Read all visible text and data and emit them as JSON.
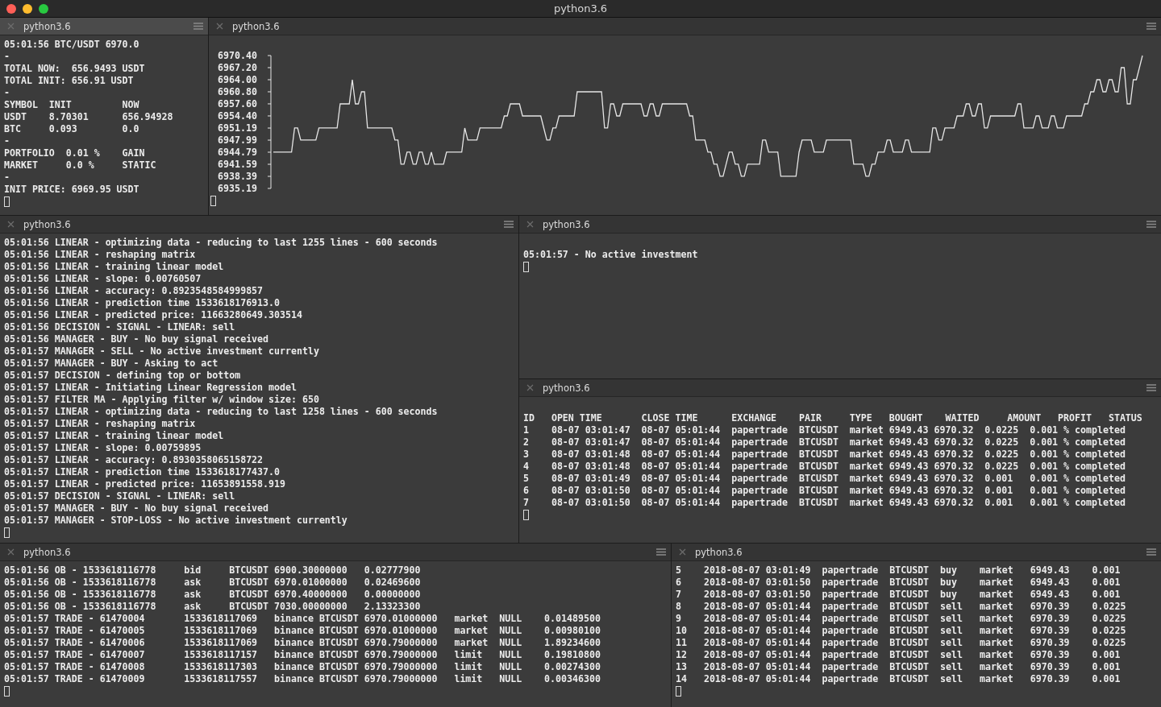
{
  "window": {
    "title": "python3.6"
  },
  "panes": [
    {
      "title": "python3.6",
      "selected": true,
      "kind": "text",
      "lines": [
        "05:01:56 BTC/USDT 6970.0",
        "-",
        "TOTAL NOW:  656.9493 USDT",
        "TOTAL INIT: 656.91 USDT",
        "-",
        "SYMBOL  INIT         NOW",
        "USDT    8.70301      656.94928",
        "BTC     0.093        0.0",
        "-",
        "PORTFOLIO  0.01 %    GAIN",
        "MARKET     0.0 %     STATIC",
        "-",
        "INIT PRICE: 6969.95 USDT"
      ]
    },
    {
      "title": "python3.6",
      "selected": false,
      "kind": "chart",
      "chart_data": {
        "type": "line",
        "ylim": [
          6935.19,
          6970.4
        ],
        "yticks": [
          {
            "value": 6970.4,
            "label": "6970.40"
          },
          {
            "value": 6967.2,
            "label": "6967.20"
          },
          {
            "value": 6964.0,
            "label": "6964.00"
          },
          {
            "value": 6960.8,
            "label": "6960.80"
          },
          {
            "value": 6957.6,
            "label": "6957.60"
          },
          {
            "value": 6954.4,
            "label": "6954.40"
          },
          {
            "value": 6951.19,
            "label": "6951.19"
          },
          {
            "value": 6947.99,
            "label": "6947.99"
          },
          {
            "value": 6944.79,
            "label": "6944.79"
          },
          {
            "value": 6941.59,
            "label": "6941.59"
          },
          {
            "value": 6938.39,
            "label": "6938.39"
          },
          {
            "value": 6935.19,
            "label": "6935.19"
          }
        ],
        "categories": [
          null,
          null,
          null,
          null,
          null,
          null,
          null,
          null,
          null,
          null,
          null,
          null,
          null,
          null,
          null,
          null,
          null,
          null,
          null,
          null,
          null,
          null,
          null,
          null,
          null,
          null,
          null,
          null,
          null,
          null,
          null,
          null,
          null,
          null,
          null,
          null,
          null,
          null,
          null,
          null,
          null,
          null,
          null,
          null,
          null,
          null,
          null,
          null,
          null,
          null,
          null,
          null,
          null,
          null,
          null,
          null,
          null,
          null,
          null,
          null,
          null,
          null,
          null,
          null,
          null,
          null,
          null,
          null,
          null,
          null,
          null,
          null,
          null,
          null,
          null,
          null,
          null,
          null,
          null,
          null,
          null,
          null,
          null,
          null,
          null,
          null,
          null,
          null,
          null,
          null,
          null,
          null,
          null,
          null,
          null,
          null,
          null,
          null,
          null,
          null,
          null,
          null,
          null,
          null,
          null,
          null,
          null,
          null,
          null,
          null,
          null,
          null,
          null,
          null,
          null,
          null,
          null,
          null,
          null,
          null,
          null,
          null,
          null,
          null,
          null,
          null,
          null,
          null,
          null,
          null,
          null,
          null,
          null,
          null,
          null,
          null,
          null,
          null,
          null,
          null,
          null,
          null,
          null,
          null,
          null,
          null,
          null,
          null,
          null,
          null,
          null,
          null,
          null,
          null,
          null,
          null,
          null,
          null,
          null,
          null,
          null,
          null,
          null,
          null,
          null,
          null,
          null,
          null,
          null,
          null,
          null,
          null,
          null,
          null,
          null,
          null,
          null,
          null,
          null,
          null,
          null,
          null,
          null,
          null,
          null,
          null,
          null,
          null,
          null,
          null,
          null,
          null,
          null,
          null,
          null,
          null,
          null,
          null,
          null,
          null,
          null,
          null,
          null,
          null,
          null,
          null,
          null,
          null,
          null,
          null,
          null,
          null,
          null,
          null,
          null,
          null,
          null,
          null,
          null,
          null,
          null,
          null,
          null,
          null,
          null,
          null,
          null,
          null,
          null,
          null,
          null,
          null,
          null,
          null,
          null,
          null,
          null,
          null,
          null,
          null,
          null,
          null,
          null,
          null,
          null,
          null,
          null,
          null,
          null,
          null,
          null,
          null,
          null,
          null,
          null,
          null,
          null,
          null,
          null,
          null,
          null,
          null,
          null,
          null,
          null,
          null,
          null,
          null,
          null,
          null,
          null,
          null,
          null,
          null,
          null,
          null,
          null,
          null,
          null,
          null,
          null,
          null,
          null,
          null,
          null,
          null,
          null
        ],
        "series": [
          {
            "color": "#e6e6e6",
            "values": [
              6944.8,
              6944.8,
              6944.8,
              6944.8,
              6944.8,
              6944.8,
              6944.8,
              6951.2,
              6951.2,
              6948,
              6948,
              6948,
              6948,
              6948,
              6948,
              6951.2,
              6951.2,
              6951.2,
              6951.2,
              6951.2,
              6951.2,
              6951.2,
              6957.6,
              6957.6,
              6957.6,
              6957.6,
              6964,
              6957.6,
              6957.6,
              6960.8,
              6960.8,
              6951.2,
              6951.2,
              6951.2,
              6951.2,
              6951.2,
              6951.2,
              6951.2,
              6951.2,
              6951.2,
              6948,
              6948,
              6941.6,
              6941.6,
              6944.8,
              6944.8,
              6941.6,
              6941.6,
              6944.8,
              6944.8,
              6941.6,
              6941.6,
              6944.8,
              6941.6,
              6941.6,
              6941.6,
              6941.6,
              6944.8,
              6944.8,
              6944.8,
              6944.8,
              6944.8,
              6944.8,
              6951.2,
              6948,
              6948,
              6948,
              6948,
              6951.2,
              6951.2,
              6951.2,
              6951.2,
              6951.2,
              6951.2,
              6951.2,
              6951.2,
              6954.4,
              6954.4,
              6957.6,
              6957.6,
              6957.6,
              6957.6,
              6954.4,
              6954.4,
              6954.4,
              6954.4,
              6954.4,
              6954.4,
              6954.4,
              6951.2,
              6948,
              6948,
              6951.2,
              6951.2,
              6954.4,
              6954.4,
              6954.4,
              6954.4,
              6954.4,
              6954.4,
              6960.8,
              6960.8,
              6960.8,
              6960.8,
              6960.8,
              6960.8,
              6960.8,
              6960.8,
              6960.8,
              6951.2,
              6951.2,
              6957.6,
              6957.6,
              6954.4,
              6954.4,
              6957.6,
              6957.6,
              6957.6,
              6957.6,
              6957.6,
              6957.6,
              6957.6,
              6954.4,
              6954.4,
              6957.6,
              6957.6,
              6954.4,
              6954.4,
              6957.6,
              6957.6,
              6957.6,
              6957.6,
              6957.6,
              6957.6,
              6957.6,
              6957.6,
              6957.6,
              6954.4,
              6954.4,
              6948,
              6948,
              6948,
              6948,
              6944.8,
              6944.8,
              6941.6,
              6941.6,
              6938.4,
              6938.4,
              6941.6,
              6944.8,
              6944.8,
              6941.6,
              6941.6,
              6938.4,
              6938.4,
              6941.6,
              6941.6,
              6941.6,
              6941.6,
              6941.6,
              6948,
              6948,
              6944.8,
              6944.8,
              6944.8,
              6944.8,
              6938.4,
              6938.4,
              6938.4,
              6938.4,
              6938.4,
              6938.4,
              6944.8,
              6948,
              6948,
              6948,
              6948,
              6944.8,
              6944.8,
              6944.8,
              6944.8,
              6948,
              6948,
              6948,
              6948,
              6948,
              6948,
              6948,
              6948,
              6948,
              6941.6,
              6941.6,
              6941.6,
              6941.6,
              6938.4,
              6938.4,
              6941.6,
              6941.6,
              6944.8,
              6944.8,
              6944.8,
              6948,
              6948,
              6944.8,
              6944.8,
              6944.8,
              6944.8,
              6948,
              6948,
              6944.8,
              6944.8,
              6944.8,
              6944.8,
              6944.8,
              6944.8,
              6944.8,
              6951.2,
              6951.2,
              6948,
              6948,
              6951.2,
              6951.2,
              6951.2,
              6951.2,
              6954.4,
              6954.4,
              6954.4,
              6957.6,
              6957.6,
              6954.4,
              6954.4,
              6957.6,
              6957.6,
              6951.2,
              6951.2,
              6954.4,
              6954.4,
              6954.4,
              6954.4,
              6954.4,
              6954.4,
              6954.4,
              6954.4,
              6954.4,
              6957.6,
              6957.6,
              6951.2,
              6951.2,
              6951.2,
              6951.2,
              6954.4,
              6954.4,
              6951.2,
              6951.2,
              6951.2,
              6954.4,
              6954.4,
              6951.2,
              6951.2,
              6951.2,
              6954.4,
              6954.4,
              6954.4,
              6954.4,
              6954.4,
              6954.4,
              6957.6,
              6957.6,
              6960.8,
              6960.8,
              6964,
              6964,
              6960.8,
              6960.8,
              6964,
              6964,
              6960.8,
              6960.8,
              6967.2,
              6967.2,
              6957.6,
              6957.6,
              6964,
              6964,
              6967.2,
              6970.4
            ]
          }
        ]
      }
    },
    {
      "title": "python3.6",
      "selected": false,
      "kind": "text",
      "lines": [
        "05:01:56 LINEAR - optimizing data - reducing to last 1255 lines - 600 seconds",
        "05:01:56 LINEAR - reshaping matrix",
        "05:01:56 LINEAR - training linear model",
        "05:01:56 LINEAR - slope: 0.00760507",
        "05:01:56 LINEAR - accuracy: 0.8923548584999857",
        "05:01:56 LINEAR - prediction time 1533618176913.0",
        "05:01:56 LINEAR - predicted price: 11663280649.303514",
        "05:01:56 DECISION - SIGNAL - LINEAR: sell",
        "05:01:56 MANAGER - BUY - No buy signal received",
        "05:01:57 MANAGER - SELL - No active investment currently",
        "05:01:57 MANAGER - BUY - Asking to act",
        "05:01:57 DECISION - defining top or bottom",
        "05:01:57 LINEAR - Initiating Linear Regression model",
        "05:01:57 FILTER MA - Applying filter w/ window size: 650",
        "05:01:57 LINEAR - optimizing data - reducing to last 1258 lines - 600 seconds",
        "05:01:57 LINEAR - reshaping matrix",
        "05:01:57 LINEAR - training linear model",
        "05:01:57 LINEAR - slope: 0.00759895",
        "05:01:57 LINEAR - accuracy: 0.8930358065158722",
        "05:01:57 LINEAR - prediction time 1533618177437.0",
        "05:01:57 LINEAR - predicted price: 11653891558.919",
        "05:01:57 DECISION - SIGNAL - LINEAR: sell",
        "05:01:57 MANAGER - BUY - No buy signal received",
        "05:01:57 MANAGER - STOP-LOSS - No active investment currently"
      ]
    },
    {
      "title": "python3.6",
      "selected": false,
      "kind": "text",
      "lines": [
        "05:01:57 - No active investment"
      ]
    },
    {
      "title": "python3.6",
      "selected": false,
      "kind": "text",
      "lines": [
        "ID   OPEN TIME       CLOSE TIME      EXCHANGE    PAIR     TYPE   BOUGHT    WAITED     AMOUNT   PROFIT   STATUS",
        "1    08-07 03:01:47  08-07 05:01:44  papertrade  BTCUSDT  market 6949.43 6970.32  0.0225  0.001 % completed",
        "2    08-07 03:01:47  08-07 05:01:44  papertrade  BTCUSDT  market 6949.43 6970.32  0.0225  0.001 % completed",
        "3    08-07 03:01:48  08-07 05:01:44  papertrade  BTCUSDT  market 6949.43 6970.32  0.0225  0.001 % completed",
        "4    08-07 03:01:48  08-07 05:01:44  papertrade  BTCUSDT  market 6949.43 6970.32  0.0225  0.001 % completed",
        "5    08-07 03:01:49  08-07 05:01:44  papertrade  BTCUSDT  market 6949.43 6970.32  0.001   0.001 % completed",
        "6    08-07 03:01:50  08-07 05:01:44  papertrade  BTCUSDT  market 6949.43 6970.32  0.001   0.001 % completed",
        "7    08-07 03:01:50  08-07 05:01:44  papertrade  BTCUSDT  market 6949.43 6970.32  0.001   0.001 % completed"
      ]
    },
    {
      "title": "python3.6",
      "selected": false,
      "kind": "text",
      "lines": [
        "05:01:56 OB - 1533618116778     bid     BTCUSDT 6900.30000000   0.02777900",
        "05:01:56 OB - 1533618116778     ask     BTCUSDT 6970.01000000   0.02469600",
        "05:01:56 OB - 1533618116778     ask     BTCUSDT 6970.40000000   0.00000000",
        "05:01:56 OB - 1533618116778     ask     BTCUSDT 7030.00000000   2.13323300",
        "05:01:57 TRADE - 61470004       1533618117069   binance BTCUSDT 6970.01000000   market  NULL    0.01489500",
        "05:01:57 TRADE - 61470005       1533618117069   binance BTCUSDT 6970.01000000   market  NULL    0.00980100",
        "05:01:57 TRADE - 61470006       1533618117069   binance BTCUSDT 6970.79000000   market  NULL    1.89234600",
        "05:01:57 TRADE - 61470007       1533618117157   binance BTCUSDT 6970.79000000   limit   NULL    0.19810800",
        "05:01:57 TRADE - 61470008       1533618117303   binance BTCUSDT 6970.79000000   limit   NULL    0.00274300",
        "05:01:57 TRADE - 61470009       1533618117557   binance BTCUSDT 6970.79000000   limit   NULL    0.00346300"
      ]
    },
    {
      "title": "python3.6",
      "selected": false,
      "kind": "text",
      "lines": [
        "5    2018-08-07 03:01:49  papertrade  BTCUSDT  buy    market   6949.43    0.001",
        "6    2018-08-07 03:01:50  papertrade  BTCUSDT  buy    market   6949.43    0.001",
        "7    2018-08-07 03:01:50  papertrade  BTCUSDT  buy    market   6949.43    0.001",
        "8    2018-08-07 05:01:44  papertrade  BTCUSDT  sell   market   6970.39    0.0225",
        "9    2018-08-07 05:01:44  papertrade  BTCUSDT  sell   market   6970.39    0.0225",
        "10   2018-08-07 05:01:44  papertrade  BTCUSDT  sell   market   6970.39    0.0225",
        "11   2018-08-07 05:01:44  papertrade  BTCUSDT  sell   market   6970.39    0.0225",
        "12   2018-08-07 05:01:44  papertrade  BTCUSDT  sell   market   6970.39    0.001",
        "13   2018-08-07 05:01:44  papertrade  BTCUSDT  sell   market   6970.39    0.001",
        "14   2018-08-07 05:01:44  papertrade  BTCUSDT  sell   market   6970.39    0.001"
      ]
    }
  ]
}
